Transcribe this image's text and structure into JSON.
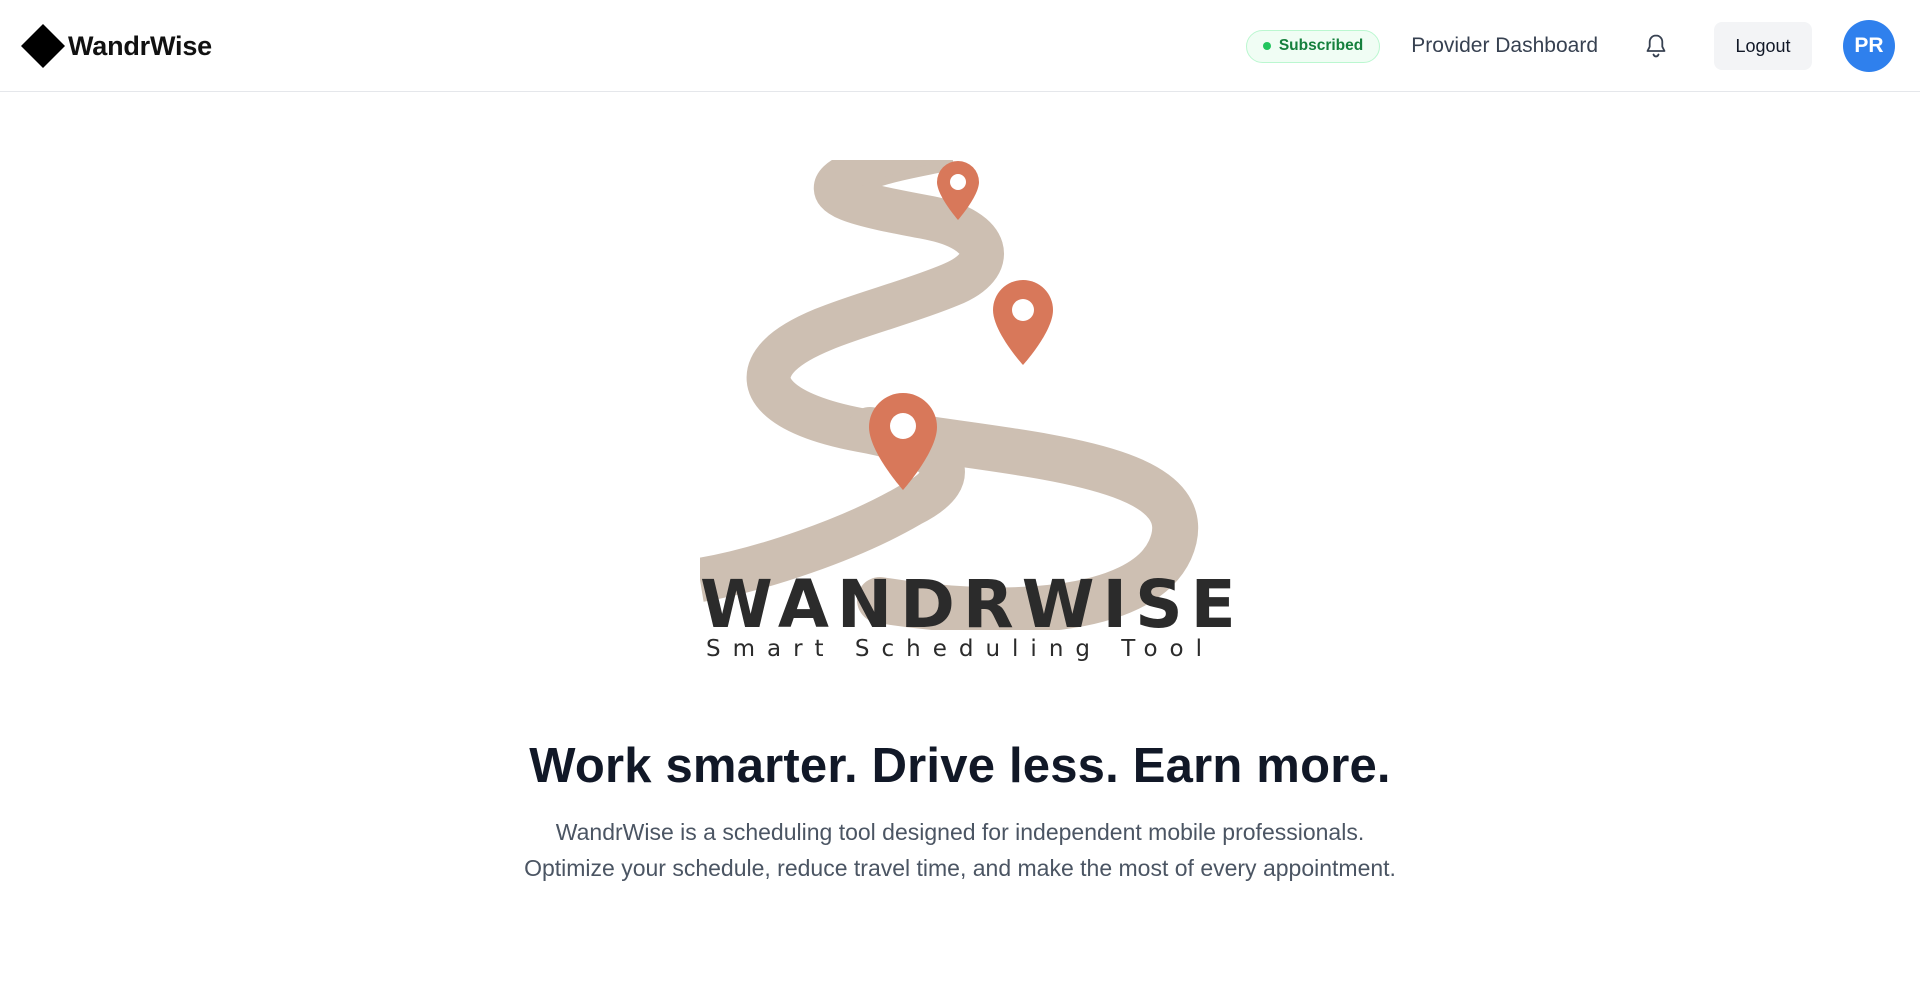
{
  "header": {
    "brand_name": "WandrWise",
    "subscription_badge": "Subscribed",
    "dashboard_link": "Provider Dashboard",
    "logout_label": "Logout",
    "avatar_initials": "PR",
    "icons": {
      "brand": "diamond-icon",
      "notifications": "bell-icon"
    }
  },
  "hero": {
    "logo_wordmark": "WANDRWISE",
    "logo_tagline": "Smart Scheduling Tool",
    "headline": "Work smarter. Drive less. Earn more.",
    "description": "WandrWise is a scheduling tool designed for independent mobile professionals. Optimize your schedule, reduce travel time, and make the most of every appointment."
  },
  "colors": {
    "accent_blue": "#2f80ed",
    "badge_green": "#15803d",
    "road": "#cdbfb2",
    "pin": "#d8785a"
  }
}
